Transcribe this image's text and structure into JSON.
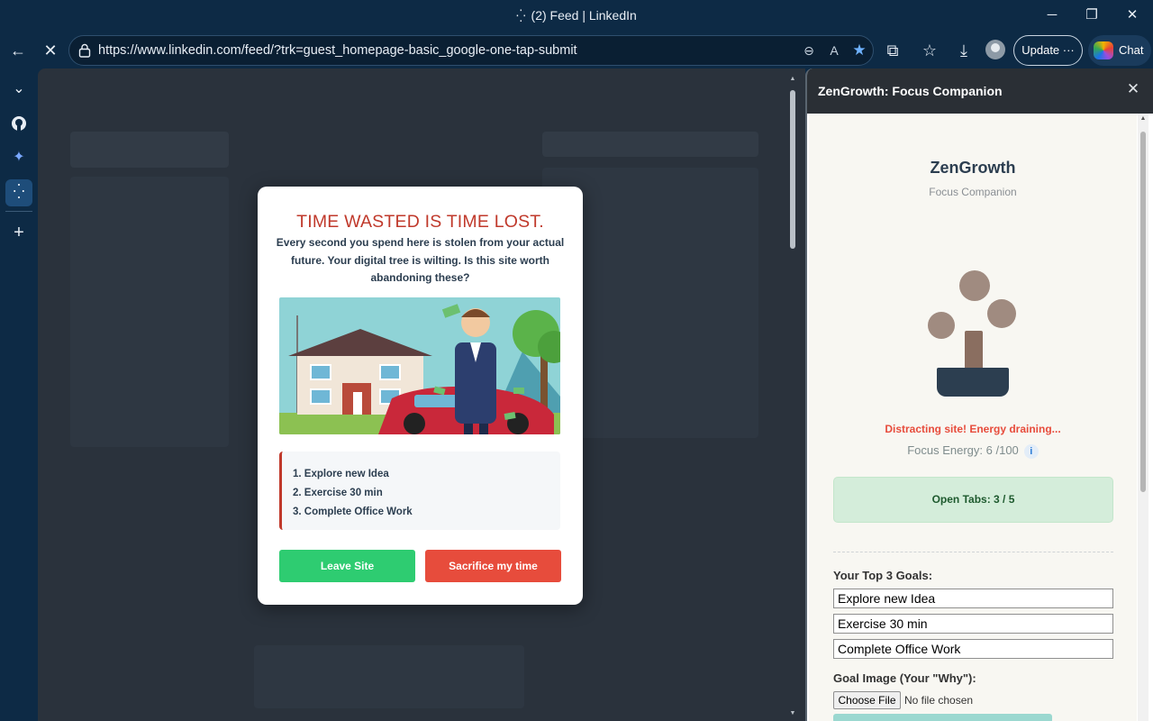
{
  "window": {
    "title": "(2) Feed | LinkedIn",
    "controls": [
      "minimize",
      "restore",
      "close"
    ]
  },
  "toolbar": {
    "url": "https://www.linkedin.com/feed/?trk=guest_homepage-basic_google-one-tap-submit",
    "update_label": "Update",
    "chat_label": "Chat"
  },
  "modal": {
    "title": "TIME WASTED IS TIME LOST.",
    "message": "Every second you spend here is stolen from your actual future. Your digital tree is wilting. Is this site worth abandoning these?",
    "goals": [
      "1. Explore new Idea",
      "2. Exercise 30 min",
      "3. Complete Office Work"
    ],
    "leave_label": "Leave Site",
    "sacrifice_label": "Sacrifice my time"
  },
  "panel": {
    "header_title": "ZenGrowth: Focus Companion",
    "app_name": "ZenGrowth",
    "app_subtitle": "Focus Companion",
    "warning": "Distracting site! Energy draining...",
    "energy_text": "Focus Energy: 6 /100",
    "info_glyph": "i",
    "tabs_text": "Open Tabs: 3 / 5",
    "goals_label": "Your Top 3 Goals:",
    "goal_inputs": [
      "Explore new Idea",
      "Exercise 30 min",
      "Complete Office Work"
    ],
    "image_label": "Goal Image (Your \"Why\"):",
    "choose_file_label": "Choose File",
    "no_file_text": "No file chosen"
  },
  "colors": {
    "modal_title": "#c0392b",
    "leave_button": "#2ecc71",
    "sacrifice_button": "#e74c3c",
    "warning_text": "#e74c3c",
    "tabs_box": "#d4edda",
    "chrome_bg": "#0d2a45"
  }
}
